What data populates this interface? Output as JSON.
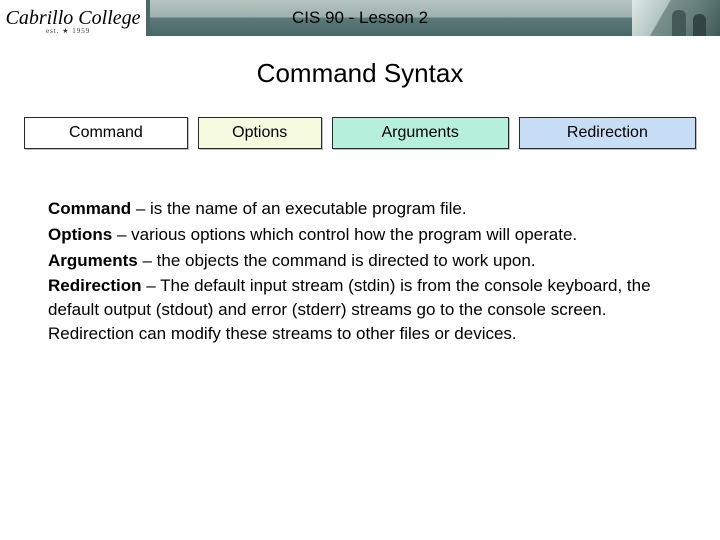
{
  "header": {
    "logo_text": "Cabrillo College",
    "logo_est": "est. ★ 1959",
    "title": "CIS 90 - Lesson 2"
  },
  "slide": {
    "title": "Command Syntax"
  },
  "chips": {
    "command": "Command",
    "options": "Options",
    "arguments": "Arguments",
    "redirection": "Redirection"
  },
  "defs": {
    "command_label": "Command",
    "command_text": " – is the name of an executable program file.",
    "options_label": "Options",
    "options_text": " – various options which control how the program will operate.",
    "arguments_label": "Arguments",
    "arguments_text": " – the objects the command is directed to work upon.",
    "redirection_label": "Redirection",
    "redirection_text": " – The default input stream (stdin)  is from the console keyboard, the default output (stdout) and error (stderr) streams go to the console screen. Redirection can modify these streams to other files or devices."
  }
}
